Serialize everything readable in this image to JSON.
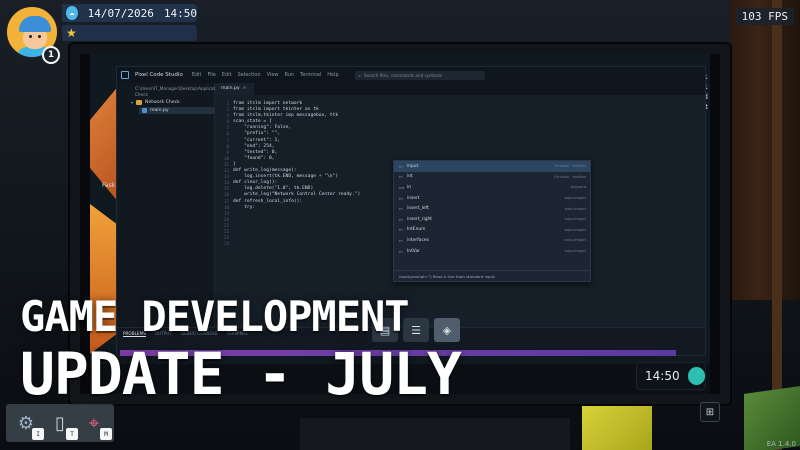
{
  "hud": {
    "date": "14/07/2026",
    "time": "14:50",
    "level": "1",
    "fps": "103 FPS",
    "weather_icon": "cloud-icon",
    "xp_icon": "star-icon"
  },
  "ide": {
    "app_name": "Pixel Code Studio",
    "menu": [
      "Edit",
      "File",
      "Edit",
      "Selection",
      "View",
      "Run",
      "Terminal",
      "Help"
    ],
    "search_placeholder": "Search files, commands and symbols",
    "sidebar_path": "C:\\Users\\IT_Manager\\Desktop\\Applications\\Python\\Network Check",
    "folder_name": "Network Check",
    "file_name": "main.py",
    "tab_name": "main.py",
    "code_lines": [
      "from itslm import network",
      "from itslm import tkinter as tk",
      "from itslm.tkinter imp messagebox, ttk",
      "",
      "scan_state = {",
      "    \"running\": False,",
      "    \"prefix\": \"\",",
      "    \"current\": 1,",
      "    \"end\": 254,",
      "    \"tested\": 0,",
      "    \"found\": 0,",
      "}",
      "",
      "",
      "def write_log(message):",
      "    log.insert(tk.END, message + \"\\n\")",
      "",
      "def clear_log():",
      "    log.delete(\"1.0\", tk.END)",
      "    write_log(\"Network Control Center ready.\")",
      "",
      "",
      "def refresh_local_info():",
      "    try:"
    ],
    "autocomplete": [
      {
        "kind": "fn",
        "label": "input",
        "detail": "Function · builtins"
      },
      {
        "kind": "fn",
        "label": "int",
        "detail": "Function · builtins"
      },
      {
        "kind": "kw",
        "label": "in",
        "detail": "Keyword"
      },
      {
        "kind": "fn",
        "label": "insert",
        "detail": "auto-import"
      },
      {
        "kind": "fn",
        "label": "insert_left",
        "detail": "auto-import"
      },
      {
        "kind": "fn",
        "label": "insert_right",
        "detail": "auto-import"
      },
      {
        "kind": "fn",
        "label": "IntEnum",
        "detail": "auto-import"
      },
      {
        "kind": "fn",
        "label": "interfaces",
        "detail": "auto-import"
      },
      {
        "kind": "fn",
        "label": "IntVar",
        "detail": "auto-import"
      }
    ],
    "autocomplete_hint": "input(prompt='') Read a line from standard input.",
    "panel_tabs": [
      "PROBLEMS",
      "OUTPUT",
      "DEBUG CONSOLE",
      "TERMINAL"
    ]
  },
  "desktop": {
    "icon_label": "Fask",
    "right_peek": [
      "1",
      "01",
      "ed",
      "at"
    ],
    "clock": "14:50",
    "grid_icon": "grid-icon"
  },
  "hotbar": [
    {
      "icon": "robot-icon",
      "key": "I"
    },
    {
      "icon": "phone-icon",
      "key": "T"
    },
    {
      "icon": "map-icon",
      "key": "M"
    }
  ],
  "version": "EA 1.4.0",
  "title": {
    "line1": "GAME DEVELOPMENT",
    "line2": "UPDATE - JULY"
  }
}
